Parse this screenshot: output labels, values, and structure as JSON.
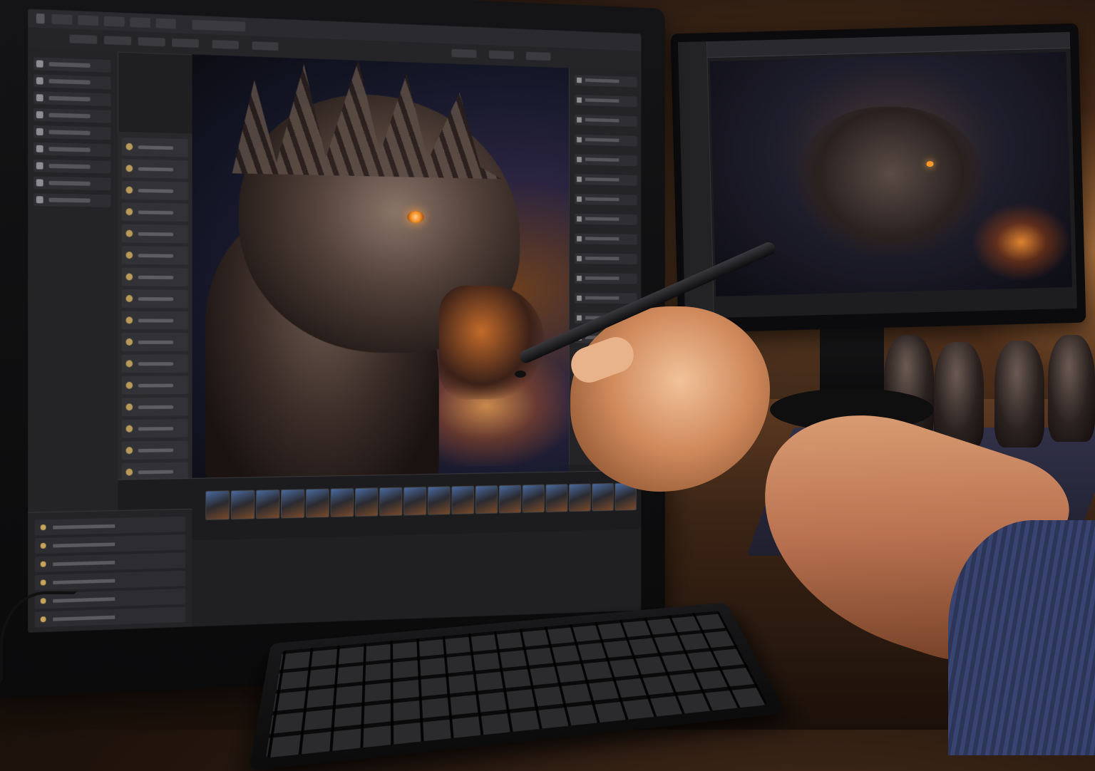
{
  "scene": {
    "main_monitor": {
      "brand_plate": "",
      "app": {
        "menu": [],
        "tools_rows": 9,
        "layer_rows": 17,
        "prop_rows": 16,
        "thumbnail_count": 18,
        "timeline_rows": 6
      },
      "canvas_subject": "dragon-head"
    },
    "second_monitor": {
      "canvas_subject": "dragon-full-body"
    },
    "colors": {
      "accent_eye": "#f08a20",
      "fire": "#ffa040",
      "ui_dark": "#1f1f22",
      "sleeve": "#3a4470"
    }
  }
}
